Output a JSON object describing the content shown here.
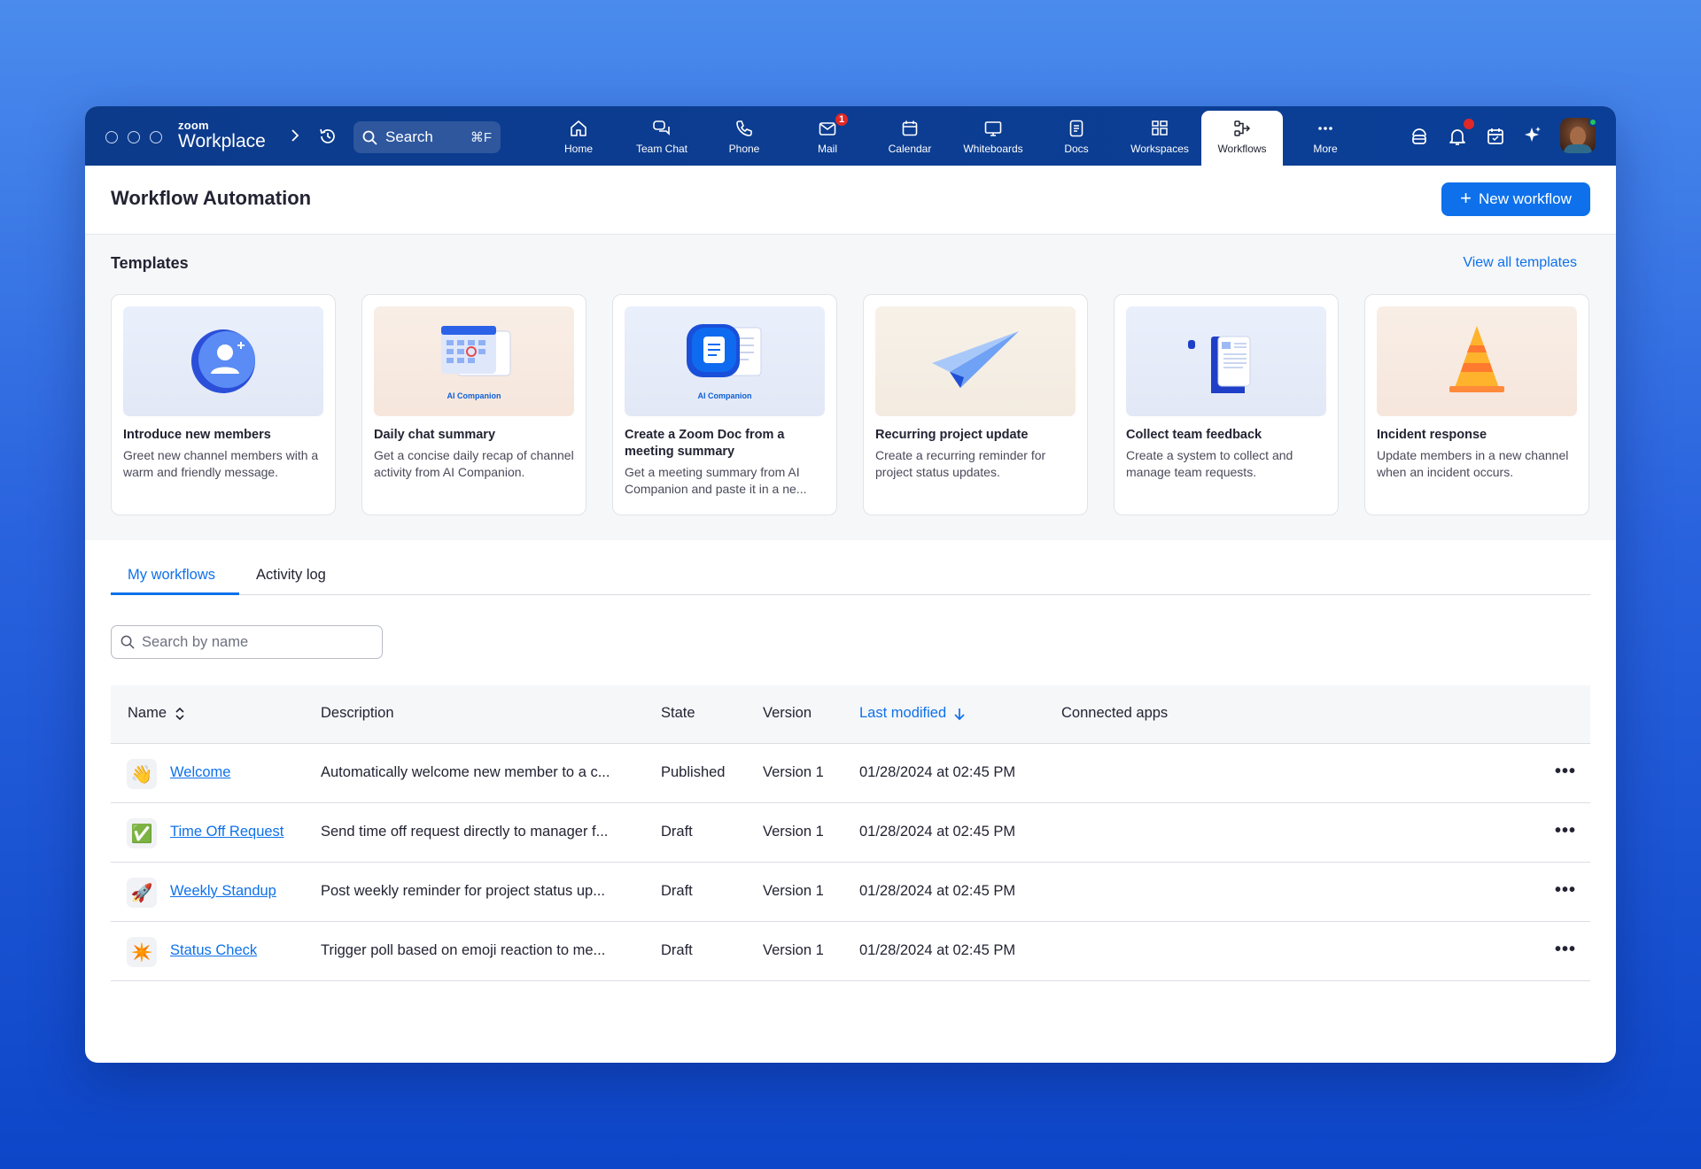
{
  "app": {
    "brand_top": "zoom",
    "brand_bottom": "Workplace",
    "search_label": "Search",
    "search_shortcut": "⌘F"
  },
  "nav": {
    "items": [
      {
        "label": "Home",
        "icon": "home-icon"
      },
      {
        "label": "Team Chat",
        "icon": "chat-icon"
      },
      {
        "label": "Phone",
        "icon": "phone-icon"
      },
      {
        "label": "Mail",
        "icon": "mail-icon",
        "badge": "1"
      },
      {
        "label": "Calendar",
        "icon": "calendar-icon"
      },
      {
        "label": "Whiteboards",
        "icon": "whiteboard-icon"
      },
      {
        "label": "Docs",
        "icon": "docs-icon"
      },
      {
        "label": "Workspaces",
        "icon": "workspaces-icon"
      },
      {
        "label": "Workflows",
        "icon": "workflows-icon",
        "active": true
      },
      {
        "label": "More",
        "icon": "more-icon"
      }
    ]
  },
  "header": {
    "title": "Workflow Automation",
    "new_button": "New workflow"
  },
  "templates": {
    "title": "Templates",
    "view_all": "View all templates",
    "ai_badge": "AI Companion",
    "cards": [
      {
        "title": "Introduce new members",
        "desc": "Greet new channel members with a warm and friendly message."
      },
      {
        "title": "Daily chat summary",
        "desc": "Get a concise daily recap of channel activity from AI Companion."
      },
      {
        "title": "Create a Zoom Doc from a meeting summary",
        "desc": "Get a meeting summary from AI Companion and paste it in a ne..."
      },
      {
        "title": "Recurring project update",
        "desc": "Create a recurring reminder for project status updates."
      },
      {
        "title": "Collect team feedback",
        "desc": "Create a system to collect and manage team requests."
      },
      {
        "title": "Incident response",
        "desc": "Update members in a new channel when an incident occurs."
      }
    ]
  },
  "tabs": [
    {
      "label": "My workflows",
      "active": true
    },
    {
      "label": "Activity log"
    }
  ],
  "search": {
    "placeholder": "Search by name"
  },
  "table": {
    "columns": [
      "Name",
      "Description",
      "State",
      "Version",
      "Last modified",
      "Connected apps"
    ],
    "rows": [
      {
        "emoji": "👋",
        "name": "Welcome",
        "description": "Automatically welcome new member to a c...",
        "state": "Published",
        "version": "Version 1",
        "modified": "01/28/2024 at 02:45 PM"
      },
      {
        "emoji": "✅",
        "name": "Time Off Request",
        "description": "Send time off request directly to manager f...",
        "state": "Draft",
        "version": "Version 1",
        "modified": "01/28/2024 at 02:45 PM"
      },
      {
        "emoji": "🚀",
        "name": "Weekly Standup",
        "description": "Post weekly reminder for project status up...",
        "state": "Draft",
        "version": "Version 1",
        "modified": "01/28/2024 at 02:45 PM"
      },
      {
        "emoji": "✴️",
        "name": "Status Check",
        "description": "Trigger poll based on emoji reaction to me...",
        "state": "Draft",
        "version": "Version 1",
        "modified": "01/28/2024 at 02:45 PM"
      }
    ]
  },
  "colors": {
    "accent": "#0e71eb",
    "topbar": "#0b3d91",
    "badge": "#e02828"
  }
}
